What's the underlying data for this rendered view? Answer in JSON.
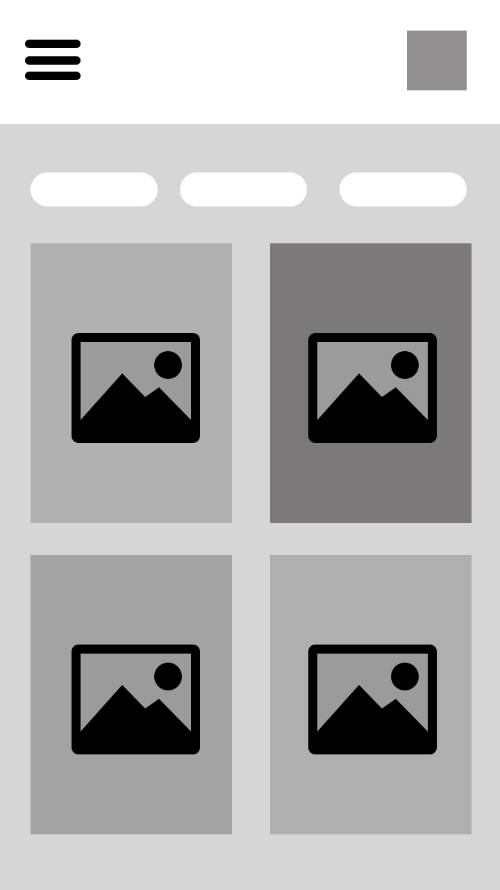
{
  "header": {
    "menu_icon": "hamburger-menu-icon",
    "avatar_color": "#918f8f"
  },
  "filters": [
    {
      "label": ""
    },
    {
      "label": ""
    },
    {
      "label": ""
    }
  ],
  "grid": {
    "cards": [
      {
        "color": "#b1b1b1",
        "icon": "image-placeholder-icon"
      },
      {
        "color": "#7b7979",
        "icon": "image-placeholder-icon"
      },
      {
        "color": "#a3a3a3",
        "icon": "image-placeholder-icon"
      },
      {
        "color": "#afafaf",
        "icon": "image-placeholder-icon"
      }
    ]
  },
  "colors": {
    "header_bg": "#ffffff",
    "content_bg": "#d6d6d6",
    "pill_bg": "#ffffff",
    "icon_frame": "#000000",
    "icon_inner": "#9b9b9b"
  }
}
